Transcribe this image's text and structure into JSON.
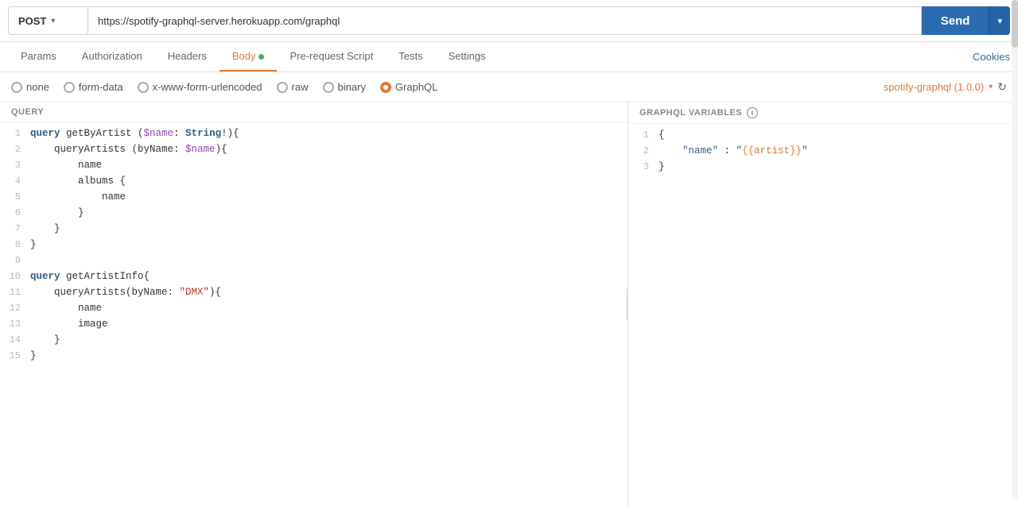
{
  "url_bar": {
    "method": "POST",
    "method_chevron": "▾",
    "url": "https://spotify-graphql-server.herokuapp.com/graphql",
    "send_label": "Send",
    "send_chevron": "▾"
  },
  "tabs": {
    "items": [
      {
        "id": "params",
        "label": "Params",
        "active": false,
        "dot": false
      },
      {
        "id": "authorization",
        "label": "Authorization",
        "active": false,
        "dot": false
      },
      {
        "id": "headers",
        "label": "Headers",
        "active": false,
        "dot": false
      },
      {
        "id": "body",
        "label": "Body",
        "active": true,
        "dot": true
      },
      {
        "id": "prerequest",
        "label": "Pre-request Script",
        "active": false,
        "dot": false
      },
      {
        "id": "tests",
        "label": "Tests",
        "active": false,
        "dot": false
      },
      {
        "id": "settings",
        "label": "Settings",
        "active": false,
        "dot": false
      }
    ],
    "cookies_label": "Cookies"
  },
  "body_options": {
    "items": [
      {
        "id": "none",
        "label": "none",
        "selected": false
      },
      {
        "id": "form-data",
        "label": "form-data",
        "selected": false
      },
      {
        "id": "x-www-form-urlencoded",
        "label": "x-www-form-urlencoded",
        "selected": false
      },
      {
        "id": "raw",
        "label": "raw",
        "selected": false
      },
      {
        "id": "binary",
        "label": "binary",
        "selected": false
      },
      {
        "id": "graphql",
        "label": "GraphQL",
        "selected": true
      }
    ],
    "schema": {
      "name": "spotify-graphql (1.0.0)",
      "chevron": "▾",
      "refresh": "↻"
    }
  },
  "query_panel": {
    "header": "QUERY",
    "lines": [
      {
        "num": 1,
        "tokens": [
          {
            "t": "kw",
            "v": "query"
          },
          {
            "t": "field",
            "v": " getByArtist"
          },
          {
            "t": "field",
            "v": " ("
          },
          {
            "t": "var",
            "v": "$name"
          },
          {
            "t": "field",
            "v": ": "
          },
          {
            "t": "kw",
            "v": "String"
          },
          {
            "t": "field",
            "v": "!){"
          }
        ]
      },
      {
        "num": 2,
        "tokens": [
          {
            "t": "field",
            "v": "    queryArtists (byName: "
          },
          {
            "t": "var",
            "v": "$name"
          },
          {
            "t": "field",
            "v": "){"
          }
        ]
      },
      {
        "num": 3,
        "tokens": [
          {
            "t": "field",
            "v": "        name"
          }
        ]
      },
      {
        "num": 4,
        "tokens": [
          {
            "t": "field",
            "v": "        albums {"
          }
        ]
      },
      {
        "num": 5,
        "tokens": [
          {
            "t": "field",
            "v": "            name"
          }
        ]
      },
      {
        "num": 6,
        "tokens": [
          {
            "t": "field",
            "v": "        }"
          }
        ]
      },
      {
        "num": 7,
        "tokens": [
          {
            "t": "field",
            "v": "    }"
          }
        ]
      },
      {
        "num": 8,
        "tokens": [
          {
            "t": "field",
            "v": "}"
          }
        ]
      },
      {
        "num": 9,
        "tokens": []
      },
      {
        "num": 10,
        "tokens": [
          {
            "t": "kw",
            "v": "query"
          },
          {
            "t": "field",
            "v": " getArtistInfo{"
          }
        ]
      },
      {
        "num": 11,
        "tokens": [
          {
            "t": "field",
            "v": "    queryArtists(byName: "
          },
          {
            "t": "str",
            "v": "\"DMX\""
          },
          {
            "t": "field",
            "v": "){"
          }
        ]
      },
      {
        "num": 12,
        "tokens": [
          {
            "t": "field",
            "v": "        name"
          }
        ]
      },
      {
        "num": 13,
        "tokens": [
          {
            "t": "field",
            "v": "        image"
          }
        ]
      },
      {
        "num": 14,
        "tokens": [
          {
            "t": "field",
            "v": "    }"
          }
        ]
      },
      {
        "num": 15,
        "tokens": [
          {
            "t": "field",
            "v": "}"
          }
        ]
      }
    ]
  },
  "variables_panel": {
    "header": "GRAPHQL VARIABLES",
    "lines": [
      {
        "num": 1,
        "content": "{",
        "type": "punct"
      },
      {
        "num": 2,
        "content": "    \"name\" : \"{{artist}}\"",
        "type": "json"
      },
      {
        "num": 3,
        "content": "}",
        "type": "punct"
      }
    ]
  }
}
